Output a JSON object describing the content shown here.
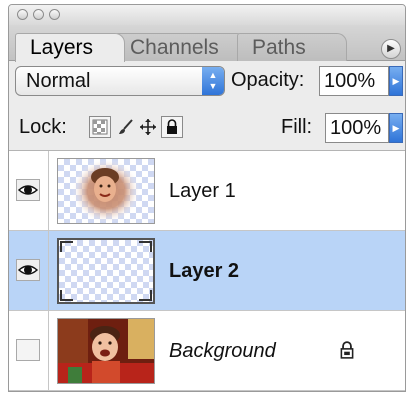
{
  "tabs": [
    {
      "label": "Layers"
    },
    {
      "label": "Channels"
    },
    {
      "label": "Paths"
    }
  ],
  "blend_mode": {
    "selected": "Normal"
  },
  "opacity": {
    "label": "Opacity:",
    "value": "100%"
  },
  "lock": {
    "label": "Lock:",
    "icons": [
      "transparent-pixels-icon",
      "brush-icon",
      "move-icon",
      "padlock-icon"
    ]
  },
  "fill": {
    "label": "Fill:",
    "value": "100%"
  },
  "layers": [
    {
      "name": "Layer 1",
      "visible": true,
      "selected": false,
      "locked": false
    },
    {
      "name": "Layer 2",
      "visible": true,
      "selected": true,
      "locked": false
    },
    {
      "name": "Background",
      "visible": false,
      "selected": false,
      "locked": true
    }
  ],
  "colors": {
    "selection": "#b9d4f7",
    "accent_blue": "#2f74d8",
    "panel": "#ececec"
  }
}
